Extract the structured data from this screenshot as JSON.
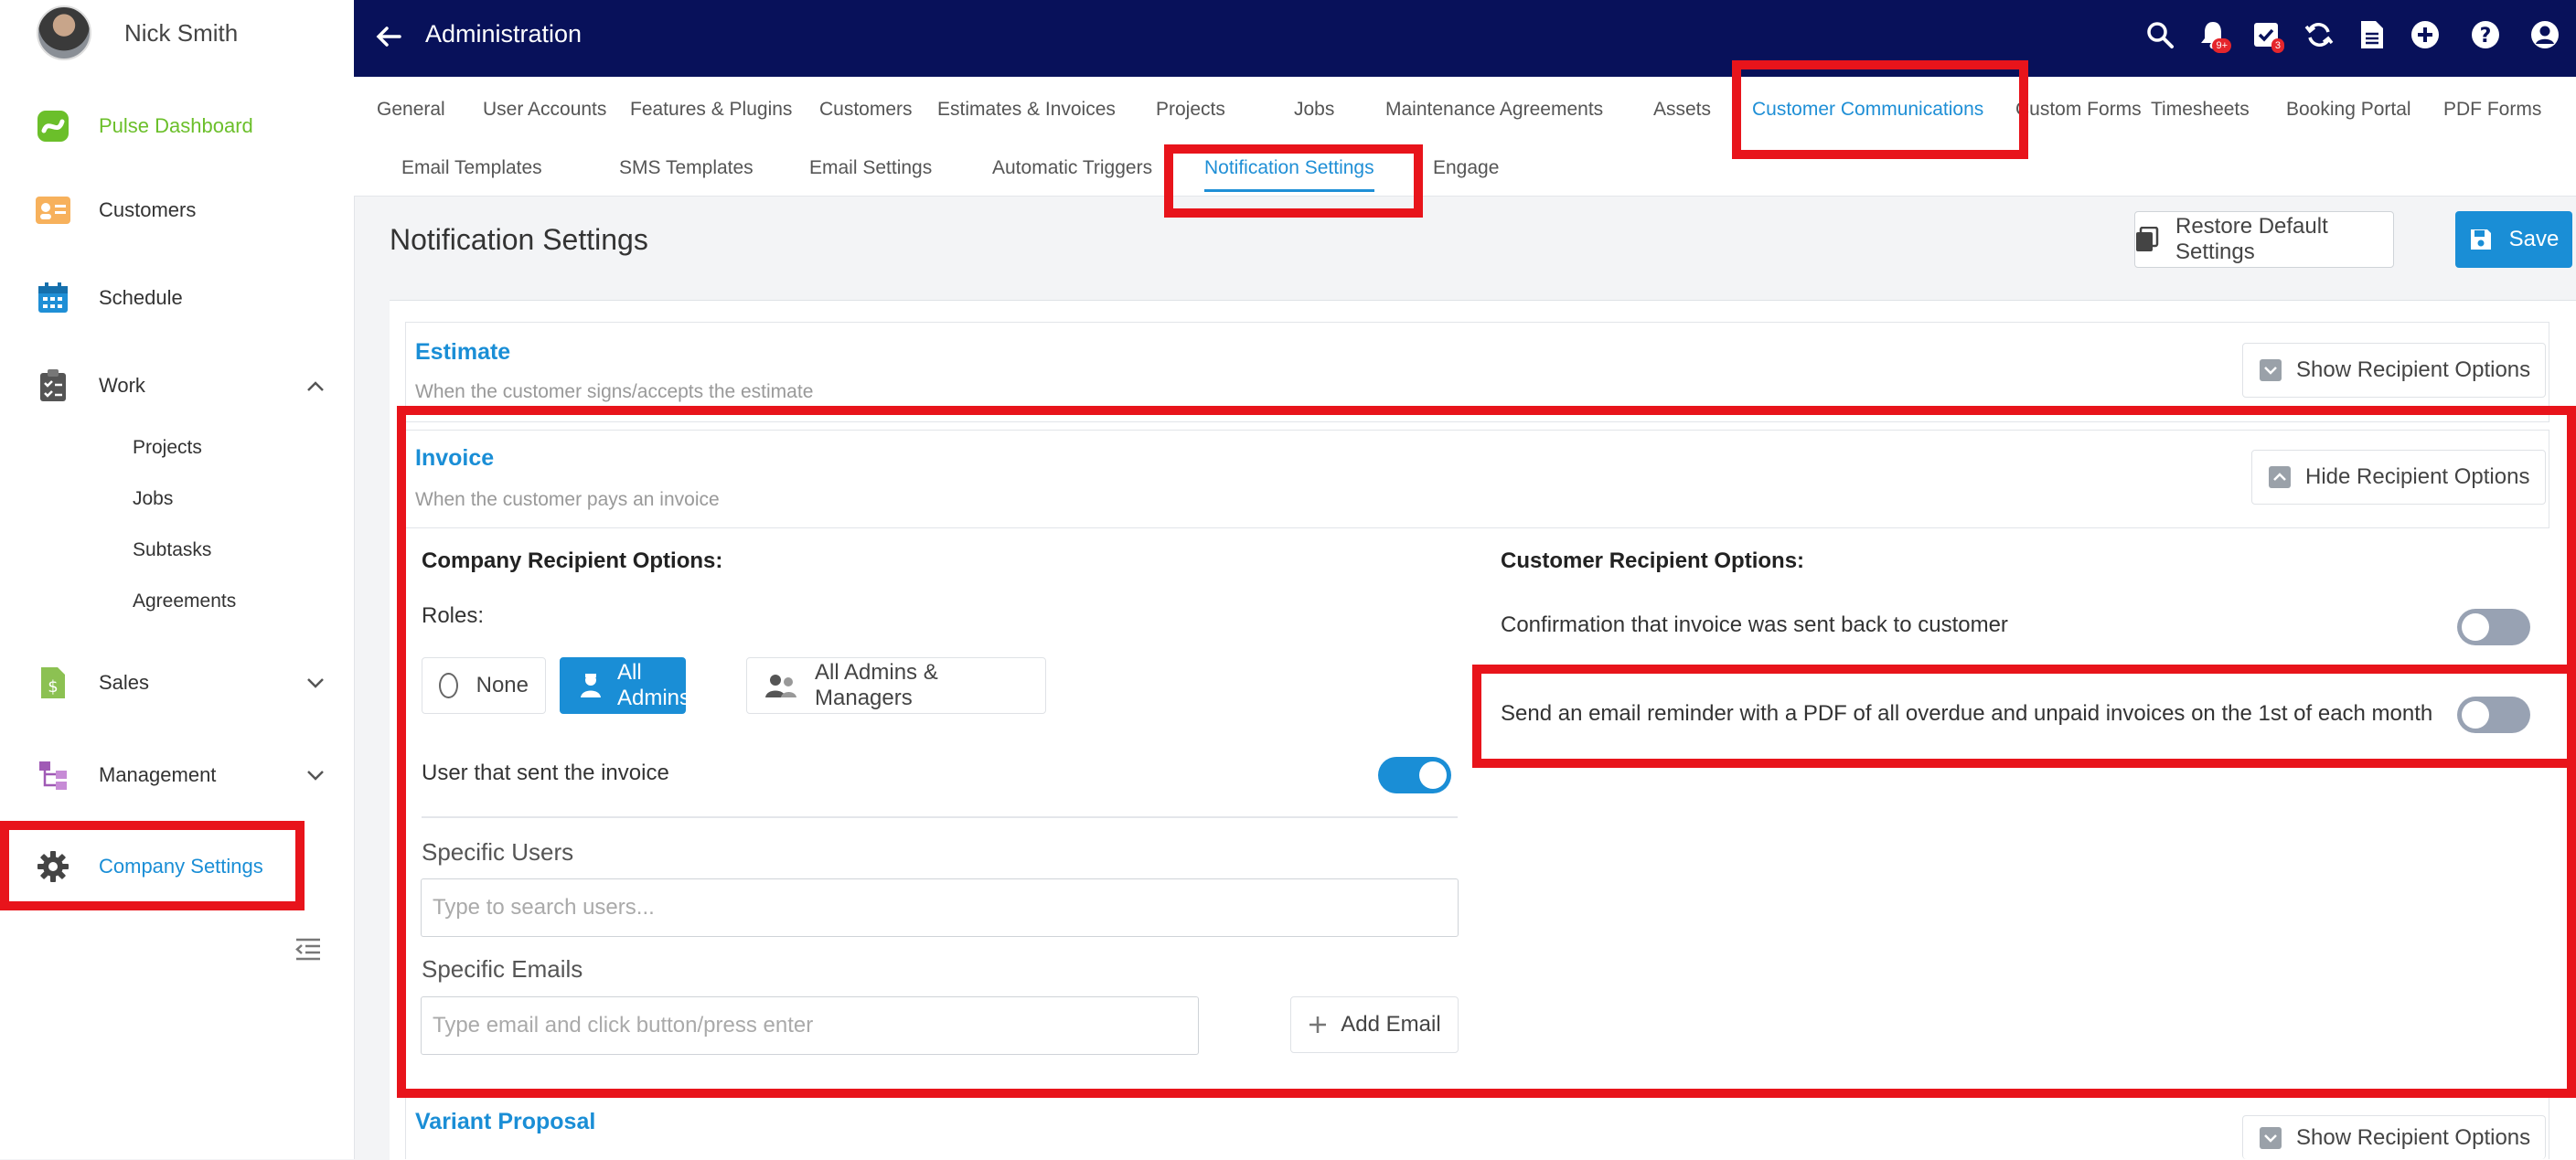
{
  "user": {
    "name": "Nick Smith"
  },
  "sidebar": {
    "items": [
      {
        "label": "Pulse Dashboard",
        "icon": "pulse-logo-icon",
        "color": "#6bbf2a"
      },
      {
        "label": "Customers",
        "icon": "customers-card-icon"
      },
      {
        "label": "Schedule",
        "icon": "calendar-icon"
      },
      {
        "label": "Work",
        "icon": "clipboard-icon"
      },
      {
        "label": "Sales",
        "icon": "dollar-doc-icon"
      },
      {
        "label": "Management",
        "icon": "org-chart-icon"
      },
      {
        "label": "Company Settings",
        "icon": "gear-icon"
      }
    ],
    "work_sub": [
      "Projects",
      "Jobs",
      "Subtasks",
      "Agreements"
    ]
  },
  "topbar": {
    "title": "Administration",
    "notif_badge": "9+",
    "tasks_badge": "3"
  },
  "tabs": [
    "General",
    "User Accounts",
    "Features & Plugins",
    "Customers",
    "Estimates & Invoices",
    "Projects",
    "Jobs",
    "Maintenance Agreements",
    "Assets",
    "Customer Communications",
    "Custom Forms",
    "Timesheets",
    "Booking Portal",
    "PDF Forms"
  ],
  "subtabs": [
    "Email Templates",
    "SMS Templates",
    "Email Settings",
    "Automatic Triggers",
    "Notification Settings",
    "Engage"
  ],
  "page": {
    "title": "Notification Settings",
    "restore_label": "Restore Default Settings",
    "save_label": "Save"
  },
  "sections": {
    "estimate": {
      "title": "Estimate",
      "subtitle": "When the customer signs/accepts the estimate",
      "button": "Show Recipient Options"
    },
    "invoice": {
      "title": "Invoice",
      "subtitle": "When the customer pays an invoice",
      "button": "Hide Recipient Options"
    },
    "variant": {
      "title": "Variant Proposal",
      "button": "Show Recipient Options"
    }
  },
  "invoice": {
    "company_heading": "Company Recipient Options:",
    "roles_label": "Roles:",
    "roles": [
      "None",
      "All Admins",
      "All Admins & Managers"
    ],
    "selected_role": "All Admins",
    "user_sent_label": "User that sent the invoice",
    "user_sent_enabled": true,
    "specific_users_label": "Specific Users",
    "specific_users_placeholder": "Type to search users...",
    "specific_emails_label": "Specific Emails",
    "specific_emails_placeholder": "Type email and click button/press enter",
    "add_email_label": "Add Email",
    "customer_heading": "Customer Recipient Options:",
    "confirm_label": "Confirmation that invoice was sent back to customer",
    "confirm_enabled": false,
    "reminder_label": "Send an email reminder with a PDF of all overdue and unpaid invoices on the 1st of each month",
    "reminder_enabled": false
  },
  "colors": {
    "navy": "#08115a",
    "accent": "#1a8ed6",
    "highlight": "#e8141b",
    "toggle_off": "#98a2b3"
  }
}
